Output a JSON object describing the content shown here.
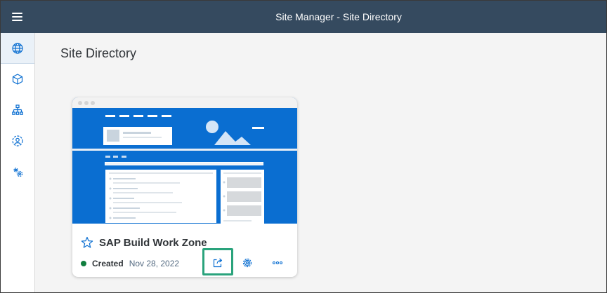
{
  "shellbar": {
    "title": "Site Manager - Site Directory",
    "color": "#354a5f"
  },
  "sidenav": {
    "items": [
      {
        "name": "site-directory",
        "icon": "globe-icon",
        "selected": true
      },
      {
        "name": "content-manager",
        "icon": "cube-icon",
        "selected": false
      },
      {
        "name": "channel-manager",
        "icon": "hierarchy-icon",
        "selected": false
      },
      {
        "name": "role-settings",
        "icon": "user-settings-icon",
        "selected": false
      },
      {
        "name": "settings",
        "icon": "gears-icon",
        "selected": false
      }
    ]
  },
  "main": {
    "page_title": "Site Directory"
  },
  "card": {
    "title": "SAP Build Work Zone",
    "status": "Created",
    "date": "Nov 28, 2022",
    "favorite_icon": "star-outline-icon",
    "actions": [
      {
        "name": "open-site-button",
        "icon": "external-link-icon",
        "highlighted": true
      },
      {
        "name": "site-settings-button",
        "icon": "gear-icon"
      },
      {
        "name": "more-options-button",
        "icon": "overflow-icon"
      }
    ],
    "thumbnail_color": "#0a6ed1",
    "status_color": "#107e3e"
  },
  "highlight_color": "#2aa37c"
}
